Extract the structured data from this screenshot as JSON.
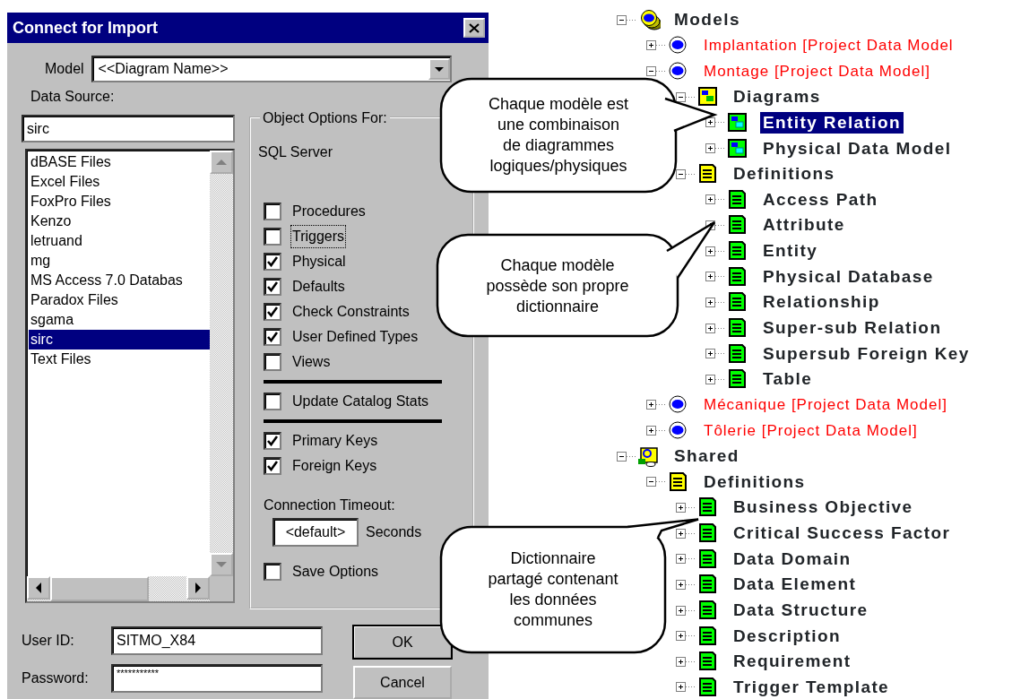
{
  "window": {
    "title": "Connect for Import"
  },
  "model": {
    "label": "Model",
    "value": "<<Diagram Name>>"
  },
  "data_source": {
    "label": "Data Source:",
    "value": "sirc",
    "items": [
      {
        "label": "dBASE Files",
        "selected": false
      },
      {
        "label": "Excel Files",
        "selected": false
      },
      {
        "label": "FoxPro Files",
        "selected": false
      },
      {
        "label": "Kenzo",
        "selected": false
      },
      {
        "label": "letruand",
        "selected": false
      },
      {
        "label": "mg",
        "selected": false
      },
      {
        "label": "MS Access 7.0 Databas",
        "selected": false
      },
      {
        "label": "Paradox Files",
        "selected": false
      },
      {
        "label": "sgama",
        "selected": false
      },
      {
        "label": "sirc",
        "selected": true
      },
      {
        "label": "Text Files",
        "selected": false
      }
    ]
  },
  "object_options": {
    "title": "Object Options For:",
    "server": "SQL Server",
    "groups": [
      [
        {
          "label": "Procedures",
          "checked": false,
          "focused": false
        },
        {
          "label": "Triggers",
          "checked": false,
          "focused": true
        },
        {
          "label": "Physical",
          "checked": true,
          "focused": false
        },
        {
          "label": "Defaults",
          "checked": true,
          "focused": false
        },
        {
          "label": "Check Constraints",
          "checked": true,
          "focused": false
        },
        {
          "label": "User Defined Types",
          "checked": true,
          "focused": false
        },
        {
          "label": "Views",
          "checked": false,
          "focused": false
        }
      ],
      [
        {
          "label": "Update Catalog Stats",
          "checked": false,
          "focused": false
        }
      ],
      [
        {
          "label": "Primary Keys",
          "checked": true,
          "focused": false
        },
        {
          "label": "Foreign Keys",
          "checked": true,
          "focused": false
        }
      ]
    ],
    "timeout": {
      "label": "Connection Timeout:",
      "value": "<default>",
      "unit": "Seconds"
    },
    "save_options": {
      "label": "Save Options",
      "checked": false,
      "focused": false
    }
  },
  "user_id": {
    "label": "User ID:",
    "value": "SITMO_X84"
  },
  "password": {
    "label": "Password:",
    "value": "***********"
  },
  "buttons": [
    {
      "label": "OK",
      "default": true
    },
    {
      "label": "Cancel",
      "default": false
    }
  ],
  "tree": [
    {
      "label": "Models",
      "kind": "models-root",
      "expanded": true,
      "selected": false,
      "children": [
        {
          "label": "Implantation  [Project Data Model",
          "kind": "model",
          "expanded": false,
          "selected": false
        },
        {
          "label": "Montage  [Project Data Model]",
          "kind": "model",
          "expanded": true,
          "selected": false,
          "children": [
            {
              "label": "Diagrams",
              "kind": "diagrams-folder",
              "expanded": true,
              "selected": false,
              "children": [
                {
                  "label": "Entity Relation",
                  "kind": "diagram",
                  "expanded": false,
                  "selected": true
                },
                {
                  "label": "Physical Data Model",
                  "kind": "diagram",
                  "expanded": false,
                  "selected": false
                }
              ]
            },
            {
              "label": "Definitions",
              "kind": "definitions-folder",
              "expanded": true,
              "selected": false,
              "children": [
                {
                  "label": "Access Path",
                  "kind": "definition",
                  "expanded": false,
                  "selected": false
                },
                {
                  "label": "Attribute",
                  "kind": "definition",
                  "expanded": false,
                  "selected": false
                },
                {
                  "label": "Entity",
                  "kind": "definition",
                  "expanded": false,
                  "selected": false
                },
                {
                  "label": "Physical Database",
                  "kind": "definition",
                  "expanded": false,
                  "selected": false
                },
                {
                  "label": "Relationship",
                  "kind": "definition",
                  "expanded": false,
                  "selected": false
                },
                {
                  "label": "Super-sub Relation",
                  "kind": "definition",
                  "expanded": false,
                  "selected": false
                },
                {
                  "label": "Supersub Foreign Key",
                  "kind": "definition",
                  "expanded": false,
                  "selected": false
                },
                {
                  "label": "Table",
                  "kind": "definition",
                  "expanded": false,
                  "selected": false
                }
              ]
            }
          ]
        },
        {
          "label": "Mécanique  [Project Data Model]",
          "kind": "model",
          "expanded": false,
          "selected": false
        },
        {
          "label": "Tôlerie  [Project Data Model]",
          "kind": "model",
          "expanded": false,
          "selected": false
        }
      ]
    },
    {
      "label": "Shared",
      "kind": "shared-root",
      "expanded": true,
      "selected": false,
      "children": [
        {
          "label": "Definitions",
          "kind": "definitions-folder",
          "expanded": true,
          "selected": false,
          "children": [
            {
              "label": "Business Objective",
              "kind": "definition",
              "expanded": false,
              "selected": false
            },
            {
              "label": "Critical Success Factor",
              "kind": "definition",
              "expanded": false,
              "selected": false
            },
            {
              "label": "Data Domain",
              "kind": "definition",
              "expanded": false,
              "selected": false
            },
            {
              "label": "Data Element",
              "kind": "definition",
              "expanded": false,
              "selected": false
            },
            {
              "label": "Data Structure",
              "kind": "definition",
              "expanded": false,
              "selected": false
            },
            {
              "label": "Description",
              "kind": "definition",
              "expanded": false,
              "selected": false
            },
            {
              "label": "Requirement",
              "kind": "definition",
              "expanded": false,
              "selected": false
            },
            {
              "label": "Trigger Template",
              "kind": "definition",
              "expanded": false,
              "selected": false
            }
          ]
        }
      ]
    }
  ],
  "callouts": [
    {
      "text": "Chaque modèle est\nune combinaison\nde diagrammes\nlogiques/physiques"
    },
    {
      "text": "Chaque modèle\npossède son propre\ndictionnaire"
    },
    {
      "text": "Dictionnaire\npartagé contenant\nles données\ncommunes"
    }
  ]
}
